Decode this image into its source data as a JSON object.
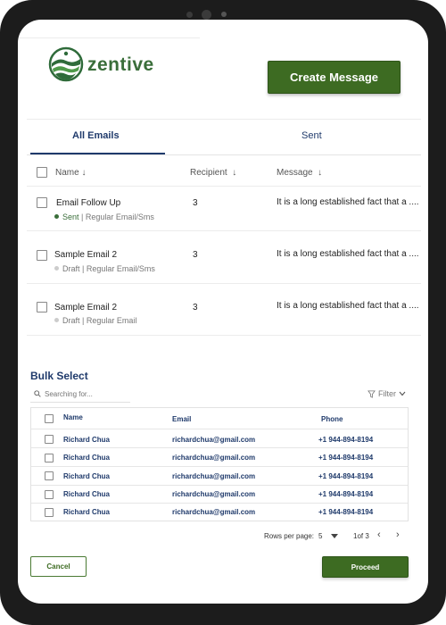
{
  "brand": {
    "name": "zentive",
    "primary": "#3d6b22",
    "navy": "#1f3a6b"
  },
  "header": {
    "create_label": "Create Message"
  },
  "tabs": [
    {
      "label": "All Emails",
      "active": true
    },
    {
      "label": "Sent",
      "active": false
    }
  ],
  "email_table": {
    "columns": [
      "Name",
      "Recipient",
      "Message"
    ],
    "sort_icon": "arrow-down-icon",
    "rows": [
      {
        "name": "Email Follow Up",
        "status": "Sent",
        "type": "| Regular Email/Sms",
        "recipient": "3",
        "message": "It is a long established fact that a ....",
        "status_color": "#3a6e3a"
      },
      {
        "name": "Sample Email 2",
        "status": "Draft",
        "type": "| Regular Email/Sms",
        "recipient": "3",
        "message": "It is a long established fact that a ....",
        "status_color": "#cccccc"
      },
      {
        "name": "Sample Email 2",
        "status": "Draft",
        "type": "| Regular Email",
        "recipient": "3",
        "message": "It is a long established fact that a ....",
        "status_color": "#cccccc"
      }
    ]
  },
  "bulk": {
    "title": "Bulk Select",
    "search_placeholder": "Searching for...",
    "filter_label": "Filter",
    "columns": [
      "Name",
      "Email",
      "Phone"
    ],
    "rows": [
      {
        "name": "Richard Chua",
        "email": "richardchua@gmail.com",
        "phone": "+1 944-894-8194"
      },
      {
        "name": "Richard Chua",
        "email": "richardchua@gmail.com",
        "phone": "+1 944-894-8194"
      },
      {
        "name": "Richard Chua",
        "email": "richardchua@gmail.com",
        "phone": "+1 944-894-8194"
      },
      {
        "name": "Richard Chua",
        "email": "richardchua@gmail.com",
        "phone": "+1 944-894-8194"
      },
      {
        "name": "Richard Chua",
        "email": "richardchua@gmail.com",
        "phone": "+1 944-894-8194"
      }
    ]
  },
  "pagination": {
    "rows_label": "Rows per page:",
    "rows_value": "5",
    "page_of": "1of 3"
  },
  "footer": {
    "cancel_label": "Cancel",
    "proceed_label": "Proceed"
  }
}
